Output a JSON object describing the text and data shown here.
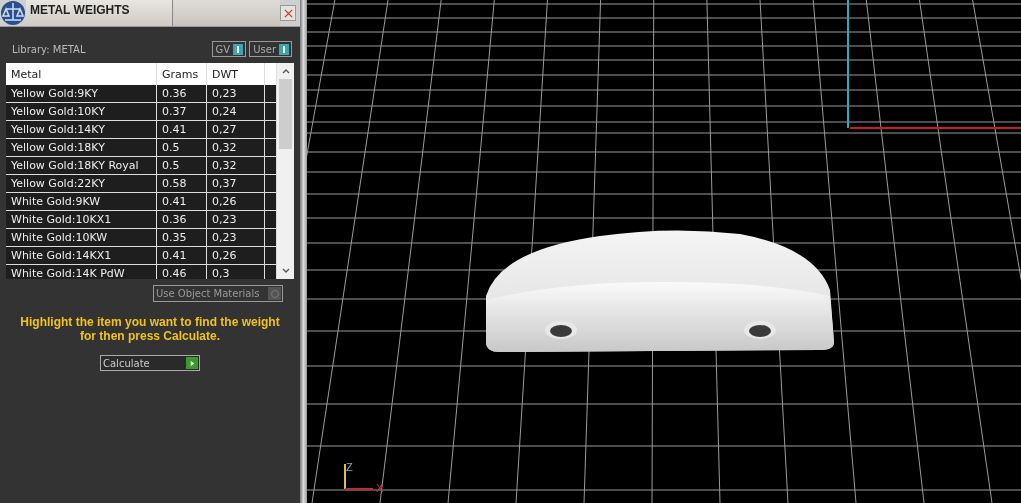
{
  "panel": {
    "title": "METAL WEIGHTS",
    "library": "Library: METAL",
    "toggles": [
      {
        "label": "GV",
        "on": true
      },
      {
        "label": "User",
        "on": true
      }
    ],
    "table": {
      "columns": [
        "Metal",
        "Grams",
        "DWT"
      ],
      "rows": [
        {
          "cells": [
            "Yellow Gold:9KY",
            "0.36",
            "0,23"
          ],
          "selected": false
        },
        {
          "cells": [
            "Yellow Gold:10KY",
            "0.37",
            "0,24"
          ],
          "selected": false
        },
        {
          "cells": [
            "Yellow Gold:14KY",
            "0.41",
            "0,27"
          ],
          "selected": false
        },
        {
          "cells": [
            "Yellow Gold:18KY",
            "0.5",
            "0,32"
          ],
          "selected": false
        },
        {
          "cells": [
            "Yellow Gold:18KY Royal",
            "0.5",
            "0,32"
          ],
          "selected": false
        },
        {
          "cells": [
            "Yellow Gold:22KY",
            "0.58",
            "0,37"
          ],
          "selected": false
        },
        {
          "cells": [
            "White Gold:9KW",
            "0.41",
            "0,26"
          ],
          "selected": false
        },
        {
          "cells": [
            "White Gold:10KX1",
            "0.36",
            "0,23"
          ],
          "selected": false
        },
        {
          "cells": [
            "White Gold:10KW",
            "0.35",
            "0,23"
          ],
          "selected": false
        },
        {
          "cells": [
            "White Gold:14KX1",
            "0.41",
            "0,26"
          ],
          "selected": false
        },
        {
          "cells": [
            "White Gold:14K PdW",
            "0.46",
            "0,3"
          ],
          "selected": false
        }
      ]
    },
    "use_object_materials": {
      "label": "Use Object Materials",
      "checked": false
    },
    "hint": "Highlight the item you want to find the weight for then press Calculate.",
    "calculate_button": "Calculate"
  },
  "viewport": {
    "axis_labels": [
      "Z",
      "X"
    ]
  }
}
